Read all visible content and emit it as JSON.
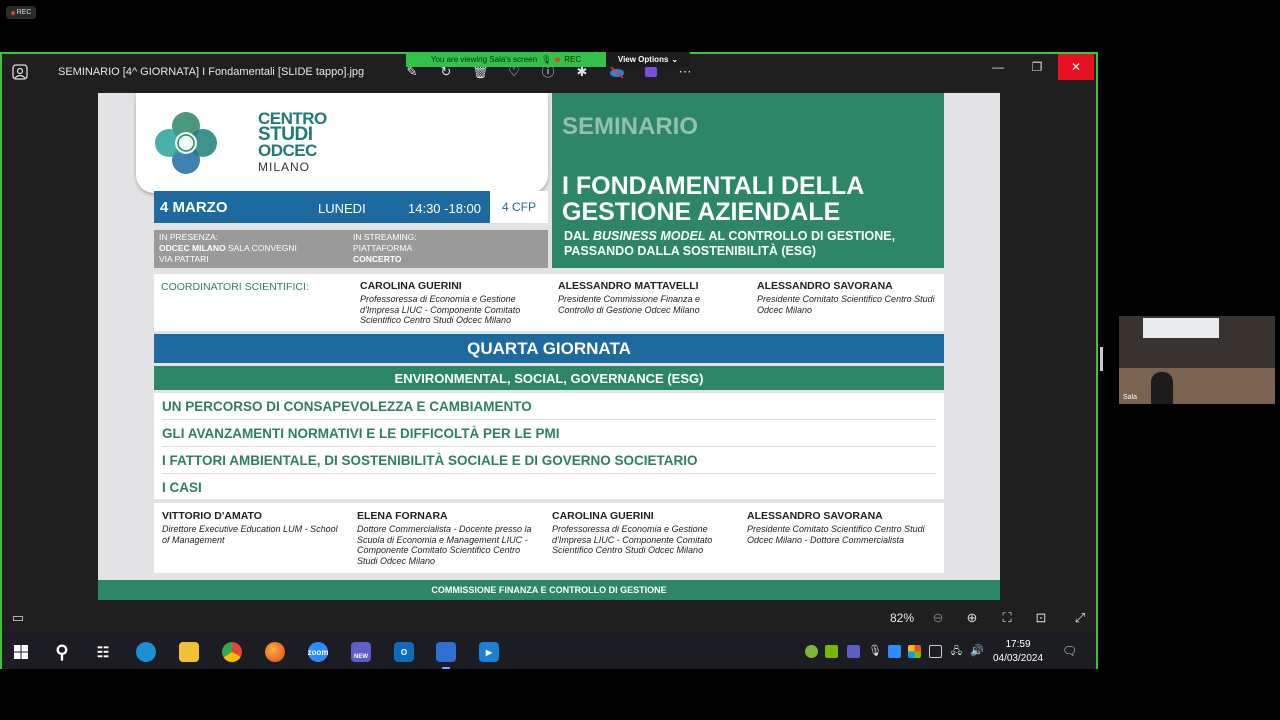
{
  "recording_badge": "REC",
  "zoom_banner": {
    "viewing_text": "You are viewing  Sala's screen",
    "rec_text": "REC",
    "view_options": "View Options"
  },
  "viewer": {
    "title": "SEMINARIO [4^ GIORNATA] I Fondamentali [SLIDE tappo].jpg",
    "zoom_level": "82%",
    "toolbar_icons": [
      "edit-icon",
      "rotate-icon",
      "delete-icon",
      "favorite-icon",
      "info-icon",
      "bug-icon",
      "cloud-icon",
      "clipchamp-icon",
      "more-icon"
    ]
  },
  "slide": {
    "logo": {
      "line1": "CENTRO",
      "line2": "STUDI",
      "line3": "ODCEC",
      "line4": "MILANO"
    },
    "date": "4 MARZO",
    "day": "LUNEDI",
    "time": "14:30 -18:00",
    "cfp": "4 CFP",
    "venue_left": {
      "line1": "IN PRESENZA:",
      "line2_bold": "ODCEC MILANO",
      "line2_rest": " SALA CONVEGNI",
      "line3": "VIA PATTARI"
    },
    "venue_right": {
      "line1": "IN STREAMING:",
      "line2": "PIATTAFORMA",
      "line3": "CONCERTO"
    },
    "seminario": "SEMINARIO",
    "main_title_line1": "I FONDAMENTALI DELLA",
    "main_title_line2": "GESTIONE AZIENDALE",
    "subtitle_prefix": "DAL ",
    "subtitle_italic": "BUSINESS MODEL",
    "subtitle_rest": " AL CONTROLLO DI GESTIONE,",
    "subtitle_line2": "PASSANDO DALLA SOSTENIBILITÀ (ESG)",
    "coordinators_label": "COORDINATORI SCIENTIFICI:",
    "coordinators": [
      {
        "name": "CAROLINA GUERINI",
        "role": "Professoressa di Economia e Gestione d'Impresa LIUC - Componente Comitato Scientifico Centro Studi Odcec Milano"
      },
      {
        "name": "ALESSANDRO MATTAVELLI",
        "role": "Presidente Commissione Finanza e Controllo di Gestione Odcec Milano"
      },
      {
        "name": "ALESSANDRO SAVORANA",
        "role": "Presidente Comitato Scientifico Centro Studi Odcec Milano"
      }
    ],
    "day_title": "QUARTA GIORNATA",
    "theme": "ENVIRONMENTAL, SOCIAL, GOVERNANCE (ESG)",
    "topics": [
      "UN PERCORSO DI CONSAPEVOLEZZA E CAMBIAMENTO",
      "GLI AVANZAMENTI NORMATIVI E LE DIFFICOLTÀ PER LE PMI",
      "I FATTORI AMBIENTALE, DI SOSTENIBILITÀ SOCIALE E DI GOVERNO SOCIETARIO",
      "I CASI"
    ],
    "speakers": [
      {
        "name": "VITTORIO D'AMATO",
        "role": "Direttore Executive Education LUM - School of Management"
      },
      {
        "name": "ELENA FORNARA",
        "role": "Dottore Commercialista - Docente presso la Scuola di Economia e Management LIUC - Componente Comitato Scientifico Centro Studi Odcec Milano"
      },
      {
        "name": "CAROLINA GUERINI",
        "role": "Professoressa di Economia e Gestione d'Impresa LIUC - Componente Comitato Scientifico Centro Studi Odcec Milano"
      },
      {
        "name": "ALESSANDRO SAVORANA",
        "role": "Presidente Comitato Scientifico Centro Studi Odcec Milano - Dottore Commercialista"
      }
    ],
    "footer": "COMMISSIONE FINANZA E CONTROLLO DI GESTIONE"
  },
  "video_thumbnail": {
    "label": "Sala"
  },
  "taskbar": {
    "apps": [
      "start-icon",
      "search-icon",
      "task-view-icon",
      "edge-icon",
      "file-explorer-icon",
      "chrome-icon",
      "firefox-icon",
      "zoom-icon",
      "teams-icon",
      "outlook-icon",
      "photos-icon",
      "media-player-icon"
    ],
    "zoom_label": "zoom",
    "teams_badge": "NEW",
    "time": "17:59",
    "date": "04/03/2024"
  },
  "colors": {
    "frame_green": "#3ec33a",
    "slide_blue": "#1d6aa0",
    "slide_green": "#2d8668",
    "close_red": "#e81123"
  }
}
